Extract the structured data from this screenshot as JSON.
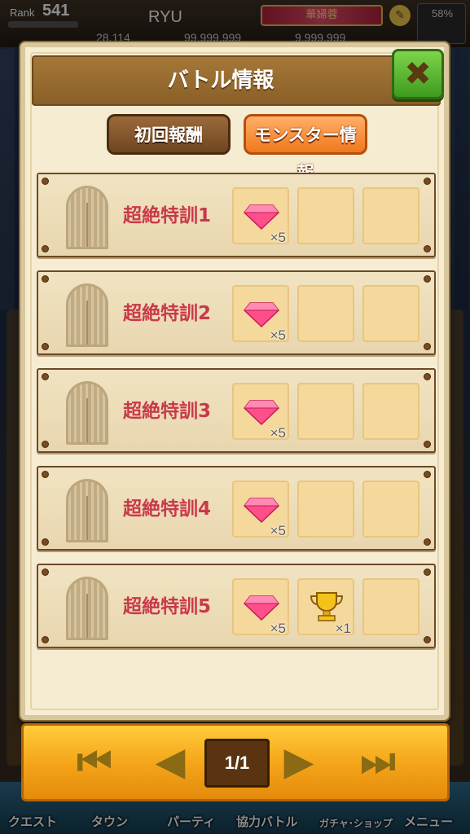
{
  "status_bar": {
    "rank_label": "Rank",
    "rank_value": "541",
    "player_name": "RYU",
    "title_badge": "華婦蓉",
    "battery_pct": "58%",
    "currency_1": "28,114",
    "currency_2": "99,999,999",
    "currency_3": "9,999,999"
  },
  "modal": {
    "title": "バトル情報",
    "close_icon": "close-icon",
    "tabs": [
      {
        "label": "初回報酬",
        "selected": false
      },
      {
        "label": "モンスター情報",
        "selected": true
      }
    ],
    "rows": [
      {
        "name": "超絶特訓1",
        "rewards": [
          {
            "icon": "gem-icon",
            "qty": "×5"
          }
        ]
      },
      {
        "name": "超絶特訓2",
        "rewards": [
          {
            "icon": "gem-icon",
            "qty": "×5"
          }
        ]
      },
      {
        "name": "超絶特訓3",
        "rewards": [
          {
            "icon": "gem-icon",
            "qty": "×5"
          }
        ]
      },
      {
        "name": "超絶特訓4",
        "rewards": [
          {
            "icon": "gem-icon",
            "qty": "×5"
          }
        ]
      },
      {
        "name": "超絶特訓5",
        "rewards": [
          {
            "icon": "gem-icon",
            "qty": "×5"
          },
          {
            "icon": "trophy-icon",
            "qty": "×1"
          }
        ]
      }
    ]
  },
  "pager": {
    "first_icon": "first-page-icon",
    "prev_icon": "prev-page-icon",
    "page": "1/1",
    "next_icon": "next-page-icon",
    "last_icon": "last-page-icon"
  },
  "bottom_nav": {
    "items": [
      "クエスト",
      "タウン",
      "パーティ",
      "協力バトル",
      "ガチャ･ショップ",
      "メニュー"
    ]
  },
  "colors": {
    "stage_name": "#c9394a",
    "close_button": "#4fae2a",
    "selected_tab": "#f58a2e",
    "pager": "#f5a61a"
  }
}
